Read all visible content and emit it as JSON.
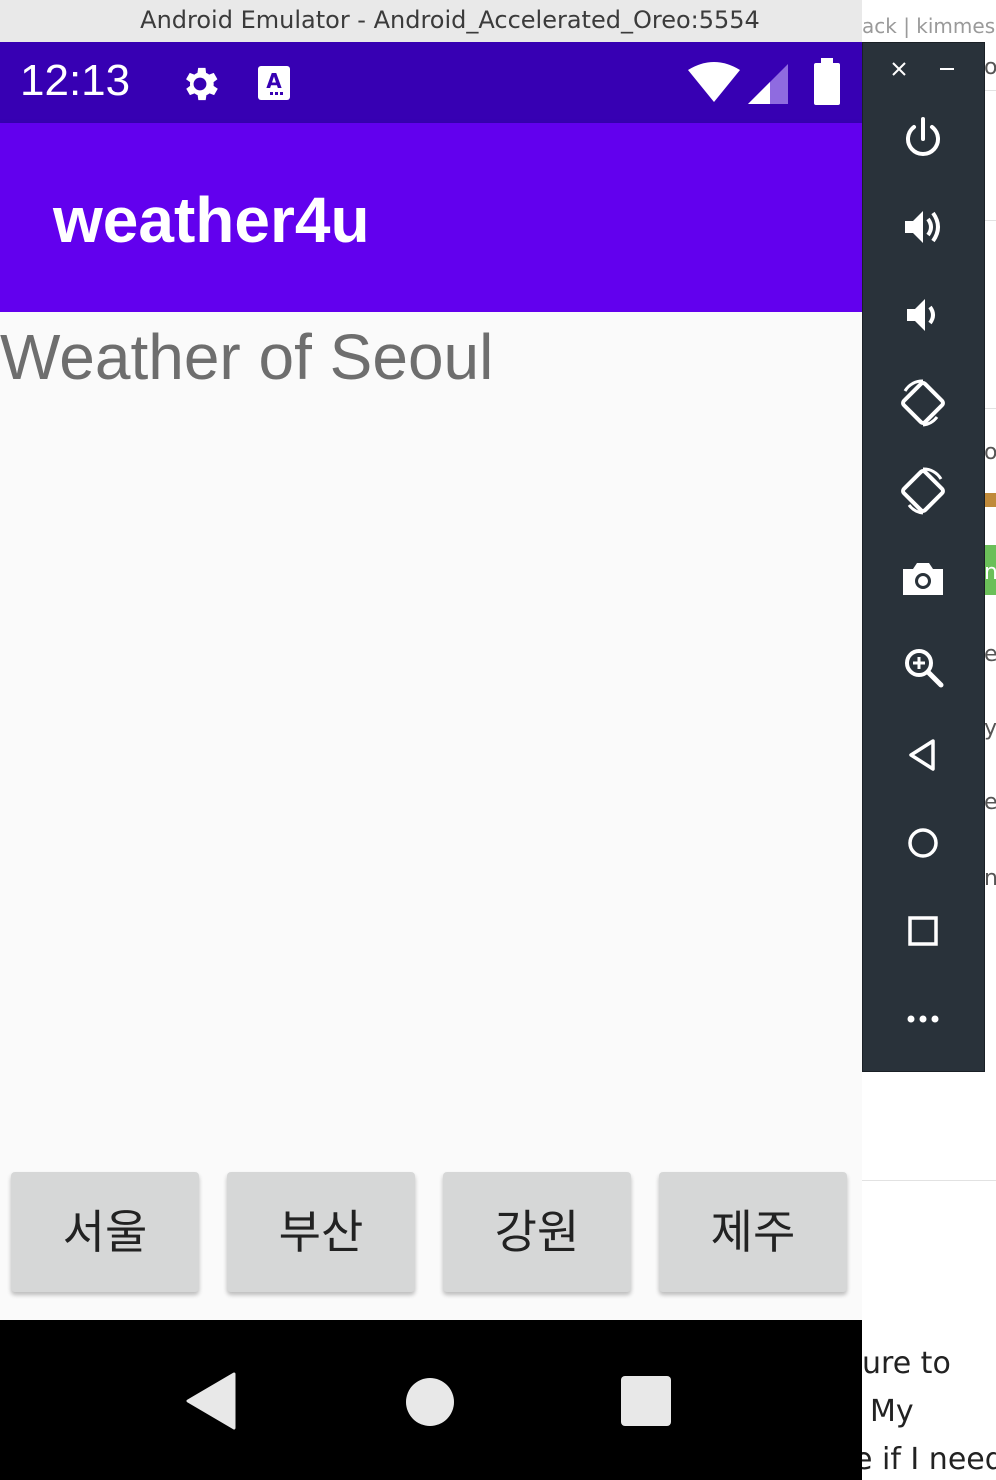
{
  "background_window": {
    "title_fragment": "ack | kimmes",
    "right_edge_fragments": [
      "o",
      "or",
      "n",
      "e",
      "ys",
      "es",
      "n"
    ],
    "text_lines": [
      "ure to",
      "My",
      "e if I need,"
    ]
  },
  "emulator": {
    "window_title": "Android Emulator - Android_Accelerated_Oreo:5554",
    "status_bar": {
      "time": "12:13",
      "icons": [
        "settings-icon",
        "keyboard-a-icon",
        "wifi-icon",
        "signal-icon",
        "battery-icon"
      ]
    },
    "app_bar": {
      "title": "weather4u"
    },
    "content": {
      "heading": "Weather of Seoul",
      "city_buttons": [
        {
          "label": "서울"
        },
        {
          "label": "부산"
        },
        {
          "label": "강원"
        },
        {
          "label": "제주"
        }
      ]
    },
    "nav_bar": {
      "buttons": [
        "back",
        "home",
        "recents"
      ]
    },
    "toolbar": {
      "window_controls": [
        "close",
        "minimize"
      ],
      "buttons": [
        "power",
        "volume-up",
        "volume-down",
        "rotate-left",
        "rotate-right",
        "screenshot",
        "zoom",
        "back",
        "home",
        "overview",
        "more"
      ]
    }
  },
  "colors": {
    "status_bar": "#3700b3",
    "app_bar": "#6200ee",
    "toolbar": "#29323a",
    "button": "#d6d7d7"
  }
}
